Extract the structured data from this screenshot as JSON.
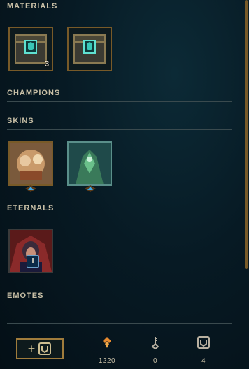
{
  "sections": {
    "materials": {
      "title": "MATERIALS",
      "items": [
        {
          "name": "Hextech Chest",
          "count": "3"
        },
        {
          "name": "Hextech Chest",
          "count": ""
        }
      ]
    },
    "champions": {
      "title": "CHAMPIONS"
    },
    "skins": {
      "title": "SKINS"
    },
    "eternals": {
      "title": "ETERNALS",
      "items": [
        {
          "badge": "I"
        }
      ]
    },
    "emotes": {
      "title": "EMOTES"
    }
  },
  "footer": {
    "add_label": "+",
    "currencies": [
      {
        "icon": "orange-essence-icon",
        "value": "1220"
      },
      {
        "icon": "key-icon",
        "value": "0"
      },
      {
        "icon": "chest-icon",
        "value": "4"
      }
    ]
  },
  "colors": {
    "gold": "#785a28",
    "text": "#c8bfa6",
    "orange": "#e88a2e"
  }
}
